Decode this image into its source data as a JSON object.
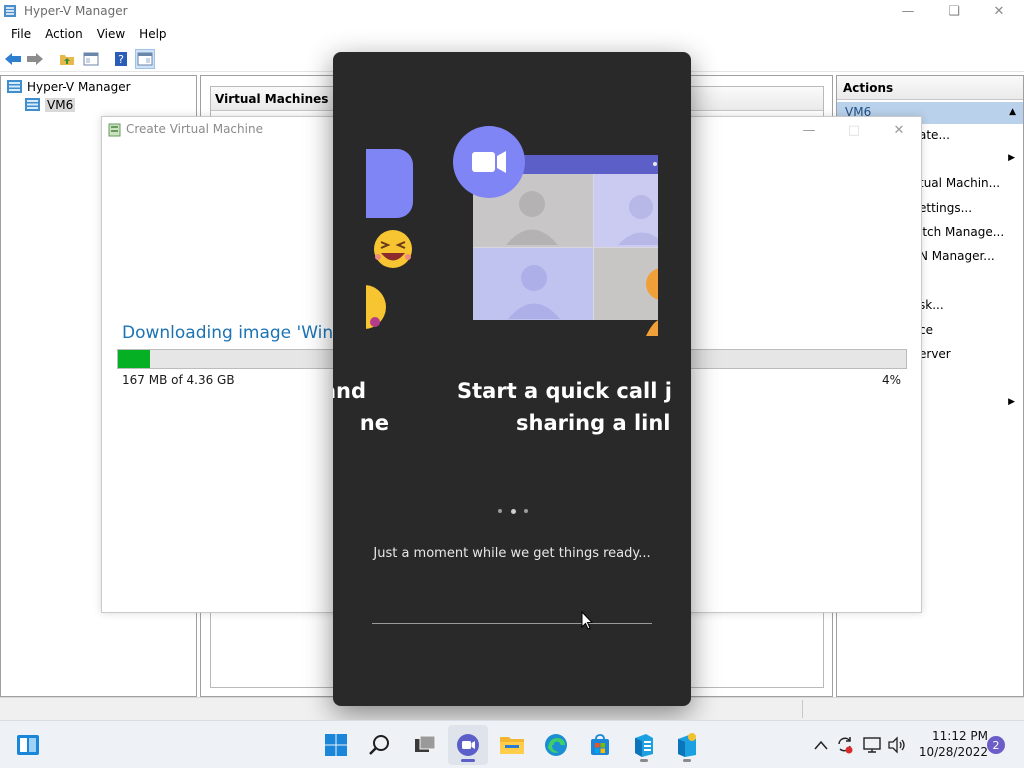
{
  "hyperv": {
    "title": "Hyper-V Manager",
    "menu": [
      "File",
      "Action",
      "View",
      "Help"
    ],
    "tree": {
      "root": "Hyper-V Manager",
      "child": "VM6"
    },
    "vm_panel_title": "Virtual Machines",
    "actions": {
      "header": "Actions",
      "selected": "VM6",
      "items": [
        "ate...",
        "",
        "tual Machin...",
        "ettings...",
        "itch Manage...",
        "N Manager...",
        "sk...",
        "ce",
        "erver",
        ""
      ]
    }
  },
  "dialog": {
    "title": "Create Virtual Machine",
    "heading": "Downloading image 'Wind",
    "size_text": "167 MB of 4.36 GB",
    "percent_text": "4%",
    "progress": 0.04
  },
  "teams": {
    "slide_prev": {
      "line1": "ily and",
      "line2": "ne"
    },
    "slide_current": {
      "line1": "Start a quick call j",
      "line2": "sharing a linl"
    },
    "message": "Just a moment while we get things ready..."
  },
  "taskbar": {
    "time": "11:12 PM",
    "date": "10/28/2022",
    "notifications": "2"
  },
  "colors": {
    "teams_bg": "#292929",
    "teams_purple": "#5b5fc7",
    "progress_green": "#06b025",
    "heading_blue": "#1c73b4",
    "action_selected": "#b9d1ea"
  }
}
